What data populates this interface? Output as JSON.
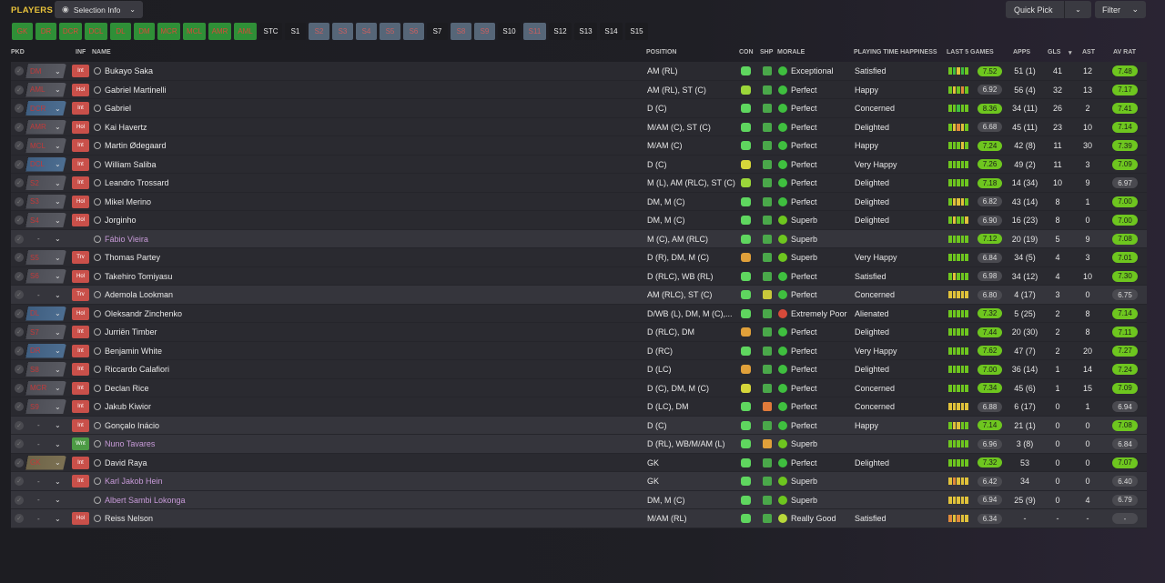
{
  "header": {
    "title": "PLAYERS",
    "selection_info": "Selection Info",
    "quick_pick": "Quick Pick",
    "filter": "Filter"
  },
  "position_buttons": [
    {
      "label": "GK",
      "style": "green"
    },
    {
      "label": "DR",
      "style": "green"
    },
    {
      "label": "DCR",
      "style": "green"
    },
    {
      "label": "DCL",
      "style": "green"
    },
    {
      "label": "DL",
      "style": "green"
    },
    {
      "label": "DM",
      "style": "green"
    },
    {
      "label": "MCR",
      "style": "green"
    },
    {
      "label": "MCL",
      "style": "green"
    },
    {
      "label": "AMR",
      "style": "green"
    },
    {
      "label": "AML",
      "style": "green"
    },
    {
      "label": "STC",
      "style": "dark"
    },
    {
      "label": "S1",
      "style": "dark"
    },
    {
      "label": "S2",
      "style": "steel"
    },
    {
      "label": "S3",
      "style": "steel"
    },
    {
      "label": "S4",
      "style": "steel"
    },
    {
      "label": "S5",
      "style": "steel"
    },
    {
      "label": "S6",
      "style": "steel"
    },
    {
      "label": "S7",
      "style": "dark"
    },
    {
      "label": "S8",
      "style": "steel"
    },
    {
      "label": "S9",
      "style": "steel"
    },
    {
      "label": "S10",
      "style": "dark"
    },
    {
      "label": "S11",
      "style": "steel"
    },
    {
      "label": "S12",
      "style": "dark"
    },
    {
      "label": "S13",
      "style": "dark"
    },
    {
      "label": "S14",
      "style": "dark"
    },
    {
      "label": "S15",
      "style": "dark"
    }
  ],
  "columns": {
    "pkd": "PKD",
    "inf": "INF",
    "name": "NAME",
    "position": "POSITION",
    "con": "CON",
    "shp": "SHP",
    "morale": "MORALE",
    "pth": "PLAYING TIME HAPPINESS",
    "last5": "LAST 5 GAMES",
    "apps": "APPS",
    "gls": "GLS",
    "sort": "▾",
    "ast": "AST",
    "avrat": "AV RAT"
  },
  "players": [
    {
      "sel": "DM",
      "selstyle": "tac",
      "inf": "Int",
      "infc": "red",
      "name": "Bukayo Saka",
      "loan": false,
      "pos": "AM (RL)",
      "con": "#5fd65f",
      "shp": "#4aa84a",
      "mor": "Exceptional",
      "morc": "#3fbf3f",
      "pth": "Satisfied",
      "bars": [
        "#6ec61f",
        "#3fbf3f",
        "#e0c23a",
        "#3fbf3f",
        "#6ec61f"
      ],
      "l5": "7.52",
      "l5g": true,
      "apps": "51 (1)",
      "gls": "41",
      "ast": "12",
      "avr": "7.48",
      "avrg": true
    },
    {
      "sel": "AML",
      "selstyle": "tac",
      "inf": "Hol",
      "infc": "red",
      "name": "Gabriel Martinelli",
      "loan": false,
      "pos": "AM (RL), ST (C)",
      "con": "#9bd63a",
      "shp": "#4aa84a",
      "mor": "Perfect",
      "morc": "#3fbf3f",
      "pth": "Happy",
      "bars": [
        "#6ec61f",
        "#e0c23a",
        "#6ec61f",
        "#e08a3a",
        "#6ec61f"
      ],
      "l5": "6.92",
      "l5g": false,
      "apps": "56 (4)",
      "gls": "32",
      "ast": "13",
      "avr": "7.17",
      "avrg": true
    },
    {
      "sel": "DCR",
      "selstyle": "fb",
      "inf": "Int",
      "infc": "red",
      "name": "Gabriel",
      "loan": false,
      "pos": "D (C)",
      "con": "#5fd65f",
      "shp": "#4aa84a",
      "mor": "Perfect",
      "morc": "#3fbf3f",
      "pth": "Concerned",
      "bars": [
        "#6ec61f",
        "#6ec61f",
        "#3fbf3f",
        "#6ec61f",
        "#6ec61f"
      ],
      "l5": "8.36",
      "l5g": true,
      "apps": "34 (11)",
      "gls": "26",
      "ast": "2",
      "avr": "7.41",
      "avrg": true
    },
    {
      "sel": "AMR",
      "selstyle": "tac",
      "inf": "Hol",
      "infc": "red",
      "name": "Kai Havertz",
      "loan": false,
      "pos": "M/AM (C), ST (C)",
      "con": "#5fd65f",
      "shp": "#4aa84a",
      "mor": "Perfect",
      "morc": "#3fbf3f",
      "pth": "Delighted",
      "bars": [
        "#6ec61f",
        "#e0c23a",
        "#e08a3a",
        "#e0c23a",
        "#6ec61f"
      ],
      "l5": "6.68",
      "l5g": false,
      "apps": "45 (11)",
      "gls": "23",
      "ast": "10",
      "avr": "7.14",
      "avrg": true
    },
    {
      "sel": "MCL",
      "selstyle": "tac",
      "inf": "Int",
      "infc": "red",
      "name": "Martin Ødegaard",
      "loan": false,
      "pos": "M/AM (C)",
      "con": "#5fd65f",
      "shp": "#4aa84a",
      "mor": "Perfect",
      "morc": "#3fbf3f",
      "pth": "Happy",
      "bars": [
        "#6ec61f",
        "#6ec61f",
        "#6ec61f",
        "#e0c23a",
        "#6ec61f"
      ],
      "l5": "7.24",
      "l5g": true,
      "apps": "42 (8)",
      "gls": "11",
      "ast": "30",
      "avr": "7.39",
      "avrg": true
    },
    {
      "sel": "DCL",
      "selstyle": "fb",
      "inf": "Int",
      "infc": "red",
      "name": "William Saliba",
      "loan": false,
      "pos": "D (C)",
      "con": "#d6d63a",
      "shp": "#4aa84a",
      "mor": "Perfect",
      "morc": "#3fbf3f",
      "pth": "Very Happy",
      "bars": [
        "#6ec61f",
        "#6ec61f",
        "#6ec61f",
        "#6ec61f",
        "#6ec61f"
      ],
      "l5": "7.26",
      "l5g": true,
      "apps": "49 (2)",
      "gls": "11",
      "ast": "3",
      "avr": "7.09",
      "avrg": true
    },
    {
      "sel": "S2",
      "selstyle": "tac",
      "inf": "Int",
      "infc": "red",
      "name": "Leandro Trossard",
      "loan": false,
      "pos": "M (L), AM (RLC), ST (C)",
      "con": "#9bd63a",
      "shp": "#4aa84a",
      "mor": "Perfect",
      "morc": "#3fbf3f",
      "pth": "Delighted",
      "bars": [
        "#6ec61f",
        "#6ec61f",
        "#6ec61f",
        "#6ec61f",
        "#6ec61f"
      ],
      "l5": "7.18",
      "l5g": true,
      "apps": "14 (34)",
      "gls": "10",
      "ast": "9",
      "avr": "6.97",
      "avrg": false
    },
    {
      "sel": "S3",
      "selstyle": "tac",
      "inf": "Hol",
      "infc": "red",
      "name": "Mikel Merino",
      "loan": false,
      "pos": "DM, M (C)",
      "con": "#5fd65f",
      "shp": "#4aa84a",
      "mor": "Perfect",
      "morc": "#3fbf3f",
      "pth": "Delighted",
      "bars": [
        "#6ec61f",
        "#e0c23a",
        "#e0c23a",
        "#e0c23a",
        "#6ec61f"
      ],
      "l5": "6.82",
      "l5g": false,
      "apps": "43 (14)",
      "gls": "8",
      "ast": "1",
      "avr": "7.00",
      "avrg": true
    },
    {
      "sel": "S4",
      "selstyle": "tac",
      "inf": "Hol",
      "infc": "red",
      "name": "Jorginho",
      "loan": false,
      "pos": "DM, M (C)",
      "con": "#5fd65f",
      "shp": "#4aa84a",
      "mor": "Superb",
      "morc": "#6ec61f",
      "pth": "Delighted",
      "bars": [
        "#6ec61f",
        "#e0c23a",
        "#6ec61f",
        "#6ec61f",
        "#e0c23a"
      ],
      "l5": "6.90",
      "l5g": false,
      "apps": "16 (23)",
      "gls": "8",
      "ast": "0",
      "avr": "7.00",
      "avrg": true
    },
    {
      "sel": "-",
      "selstyle": "none",
      "inf": "",
      "infc": "",
      "name": "Fábio Vieira",
      "loan": true,
      "pos": "M (C), AM (RLC)",
      "con": "#5fd65f",
      "shp": "#4aa84a",
      "mor": "Superb",
      "morc": "#6ec61f",
      "pth": "",
      "bars": [
        "#6ec61f",
        "#6ec61f",
        "#6ec61f",
        "#6ec61f",
        "#6ec61f"
      ],
      "l5": "7.12",
      "l5g": true,
      "apps": "20 (19)",
      "gls": "5",
      "ast": "9",
      "avr": "7.08",
      "avrg": true
    },
    {
      "sel": "S5",
      "selstyle": "tac",
      "inf": "Trv",
      "infc": "red",
      "name": "Thomas Partey",
      "loan": false,
      "pos": "D (R), DM, M (C)",
      "con": "#e0a03a",
      "shp": "#4aa84a",
      "mor": "Superb",
      "morc": "#6ec61f",
      "pth": "Very Happy",
      "bars": [
        "#6ec61f",
        "#6ec61f",
        "#6ec61f",
        "#6ec61f",
        "#6ec61f"
      ],
      "l5": "6.84",
      "l5g": false,
      "apps": "34 (5)",
      "gls": "4",
      "ast": "3",
      "avr": "7.01",
      "avrg": true
    },
    {
      "sel": "S6",
      "selstyle": "tac",
      "inf": "Hol",
      "infc": "red",
      "name": "Takehiro Tomiyasu",
      "loan": false,
      "pos": "D (RLC), WB (RL)",
      "con": "#5fd65f",
      "shp": "#4aa84a",
      "mor": "Perfect",
      "morc": "#3fbf3f",
      "pth": "Satisfied",
      "bars": [
        "#6ec61f",
        "#e0c23a",
        "#6ec61f",
        "#6ec61f",
        "#6ec61f"
      ],
      "l5": "6.98",
      "l5g": false,
      "apps": "34 (12)",
      "gls": "4",
      "ast": "10",
      "avr": "7.30",
      "avrg": true
    },
    {
      "sel": "-",
      "selstyle": "none",
      "inf": "Trv",
      "infc": "red",
      "name": "Ademola Lookman",
      "loan": false,
      "pos": "AM (RLC), ST (C)",
      "con": "#5fd65f",
      "shp": "#c8c83a",
      "mor": "Perfect",
      "morc": "#3fbf3f",
      "pth": "Concerned",
      "bars": [
        "#e0c23a",
        "#e0c23a",
        "#e0c23a",
        "#e0c23a",
        "#e0c23a"
      ],
      "l5": "6.80",
      "l5g": false,
      "apps": "4 (17)",
      "gls": "3",
      "ast": "0",
      "avr": "6.75",
      "avrg": false
    },
    {
      "sel": "DL",
      "selstyle": "fb",
      "inf": "Hol",
      "infc": "red",
      "name": "Oleksandr Zinchenko",
      "loan": false,
      "pos": "D/WB (L), DM, M (C),...",
      "con": "#5fd65f",
      "shp": "#4aa84a",
      "mor": "Extremely Poor",
      "morc": "#d84a3a",
      "pth": "Alienated",
      "bars": [
        "#6ec61f",
        "#6ec61f",
        "#6ec61f",
        "#6ec61f",
        "#6ec61f"
      ],
      "l5": "7.32",
      "l5g": true,
      "apps": "5 (25)",
      "gls": "2",
      "ast": "8",
      "avr": "7.14",
      "avrg": true
    },
    {
      "sel": "S7",
      "selstyle": "tac",
      "inf": "Int",
      "infc": "red",
      "name": "Jurriën Timber",
      "loan": false,
      "pos": "D (RLC), DM",
      "con": "#e0a03a",
      "shp": "#4aa84a",
      "mor": "Perfect",
      "morc": "#3fbf3f",
      "pth": "Delighted",
      "bars": [
        "#6ec61f",
        "#6ec61f",
        "#6ec61f",
        "#6ec61f",
        "#6ec61f"
      ],
      "l5": "7.44",
      "l5g": true,
      "apps": "20 (30)",
      "gls": "2",
      "ast": "8",
      "avr": "7.11",
      "avrg": true
    },
    {
      "sel": "DR",
      "selstyle": "fb",
      "inf": "Int",
      "infc": "red",
      "name": "Benjamin White",
      "loan": false,
      "pos": "D (RC)",
      "con": "#5fd65f",
      "shp": "#4aa84a",
      "mor": "Perfect",
      "morc": "#3fbf3f",
      "pth": "Very Happy",
      "bars": [
        "#6ec61f",
        "#6ec61f",
        "#6ec61f",
        "#6ec61f",
        "#6ec61f"
      ],
      "l5": "7.62",
      "l5g": true,
      "apps": "47 (7)",
      "gls": "2",
      "ast": "20",
      "avr": "7.27",
      "avrg": true
    },
    {
      "sel": "S8",
      "selstyle": "tac",
      "inf": "Int",
      "infc": "red",
      "name": "Riccardo Calafiori",
      "loan": false,
      "pos": "D (LC)",
      "con": "#e0a03a",
      "shp": "#4aa84a",
      "mor": "Perfect",
      "morc": "#3fbf3f",
      "pth": "Delighted",
      "bars": [
        "#6ec61f",
        "#6ec61f",
        "#6ec61f",
        "#6ec61f",
        "#6ec61f"
      ],
      "l5": "7.00",
      "l5g": true,
      "apps": "36 (14)",
      "gls": "1",
      "ast": "14",
      "avr": "7.24",
      "avrg": true
    },
    {
      "sel": "MCR",
      "selstyle": "tac",
      "inf": "Int",
      "infc": "red",
      "name": "Declan Rice",
      "loan": false,
      "pos": "D (C), DM, M (C)",
      "con": "#d6d63a",
      "shp": "#4aa84a",
      "mor": "Perfect",
      "morc": "#3fbf3f",
      "pth": "Concerned",
      "bars": [
        "#6ec61f",
        "#6ec61f",
        "#6ec61f",
        "#6ec61f",
        "#6ec61f"
      ],
      "l5": "7.34",
      "l5g": true,
      "apps": "45 (6)",
      "gls": "1",
      "ast": "15",
      "avr": "7.09",
      "avrg": true
    },
    {
      "sel": "S9",
      "selstyle": "tac",
      "inf": "Int",
      "infc": "red",
      "name": "Jakub Kiwior",
      "loan": false,
      "pos": "D (LC), DM",
      "con": "#5fd65f",
      "shp": "#e07a3a",
      "mor": "Perfect",
      "morc": "#3fbf3f",
      "pth": "Concerned",
      "bars": [
        "#e0c23a",
        "#e0c23a",
        "#e0c23a",
        "#e0c23a",
        "#e0c23a"
      ],
      "l5": "6.88",
      "l5g": false,
      "apps": "6 (17)",
      "gls": "0",
      "ast": "1",
      "avr": "6.94",
      "avrg": false
    },
    {
      "sel": "-",
      "selstyle": "none",
      "inf": "Int",
      "infc": "red",
      "name": "Gonçalo Inácio",
      "loan": false,
      "pos": "D (C)",
      "con": "#5fd65f",
      "shp": "#4aa84a",
      "mor": "Perfect",
      "morc": "#3fbf3f",
      "pth": "Happy",
      "bars": [
        "#6ec61f",
        "#e0c23a",
        "#e0c23a",
        "#6ec61f",
        "#6ec61f"
      ],
      "l5": "7.14",
      "l5g": true,
      "apps": "21 (1)",
      "gls": "0",
      "ast": "0",
      "avr": "7.08",
      "avrg": true
    },
    {
      "sel": "-",
      "selstyle": "none",
      "inf": "Wnt",
      "infc": "grn",
      "name": "Nuno Tavares",
      "loan": true,
      "pos": "D (RL), WB/M/AM (L)",
      "con": "#5fd65f",
      "shp": "#e0a03a",
      "mor": "Superb",
      "morc": "#6ec61f",
      "pth": "",
      "bars": [
        "#6ec61f",
        "#6ec61f",
        "#6ec61f",
        "#6ec61f",
        "#6ec61f"
      ],
      "l5": "6.96",
      "l5g": false,
      "apps": "3 (8)",
      "gls": "0",
      "ast": "0",
      "avr": "6.84",
      "avrg": false
    },
    {
      "sel": "GK",
      "selstyle": "gkb",
      "inf": "Int",
      "infc": "red",
      "name": "David Raya",
      "loan": false,
      "pos": "GK",
      "con": "#5fd65f",
      "shp": "#4aa84a",
      "mor": "Perfect",
      "morc": "#3fbf3f",
      "pth": "Delighted",
      "bars": [
        "#6ec61f",
        "#6ec61f",
        "#6ec61f",
        "#6ec61f",
        "#6ec61f"
      ],
      "l5": "7.32",
      "l5g": true,
      "apps": "53",
      "gls": "0",
      "ast": "0",
      "avr": "7.07",
      "avrg": true
    },
    {
      "sel": "-",
      "selstyle": "none",
      "inf": "Int",
      "infc": "red",
      "name": "Karl Jakob Hein",
      "loan": true,
      "pos": "GK",
      "con": "#5fd65f",
      "shp": "#4aa84a",
      "mor": "Superb",
      "morc": "#6ec61f",
      "pth": "",
      "bars": [
        "#e0c23a",
        "#e08a3a",
        "#e0c23a",
        "#e0c23a",
        "#e0c23a"
      ],
      "l5": "6.42",
      "l5g": false,
      "apps": "34",
      "gls": "0",
      "ast": "0",
      "avr": "6.40",
      "avrg": false
    },
    {
      "sel": "-",
      "selstyle": "none",
      "inf": "",
      "infc": "",
      "name": "Albert Sambi Lokonga",
      "loan": true,
      "pos": "DM, M (C)",
      "con": "#5fd65f",
      "shp": "#4aa84a",
      "mor": "Superb",
      "morc": "#6ec61f",
      "pth": "",
      "bars": [
        "#e0c23a",
        "#e0c23a",
        "#e0c23a",
        "#e0c23a",
        "#e0c23a"
      ],
      "l5": "6.94",
      "l5g": false,
      "apps": "25 (9)",
      "gls": "0",
      "ast": "4",
      "avr": "6.79",
      "avrg": false
    },
    {
      "sel": "-",
      "selstyle": "none",
      "inf": "Hol",
      "infc": "red",
      "name": "Reiss Nelson",
      "loan": false,
      "pos": "M/AM (RL)",
      "con": "#5fd65f",
      "shp": "#4aa84a",
      "mor": "Really Good",
      "morc": "#b8d83a",
      "pth": "Satisfied",
      "bars": [
        "#e08a3a",
        "#e0c23a",
        "#e08a3a",
        "#e0c23a",
        "#e0c23a"
      ],
      "l5": "6.34",
      "l5g": false,
      "apps": "-",
      "gls": "-",
      "ast": "-",
      "avr": "-",
      "avrg": false
    }
  ]
}
